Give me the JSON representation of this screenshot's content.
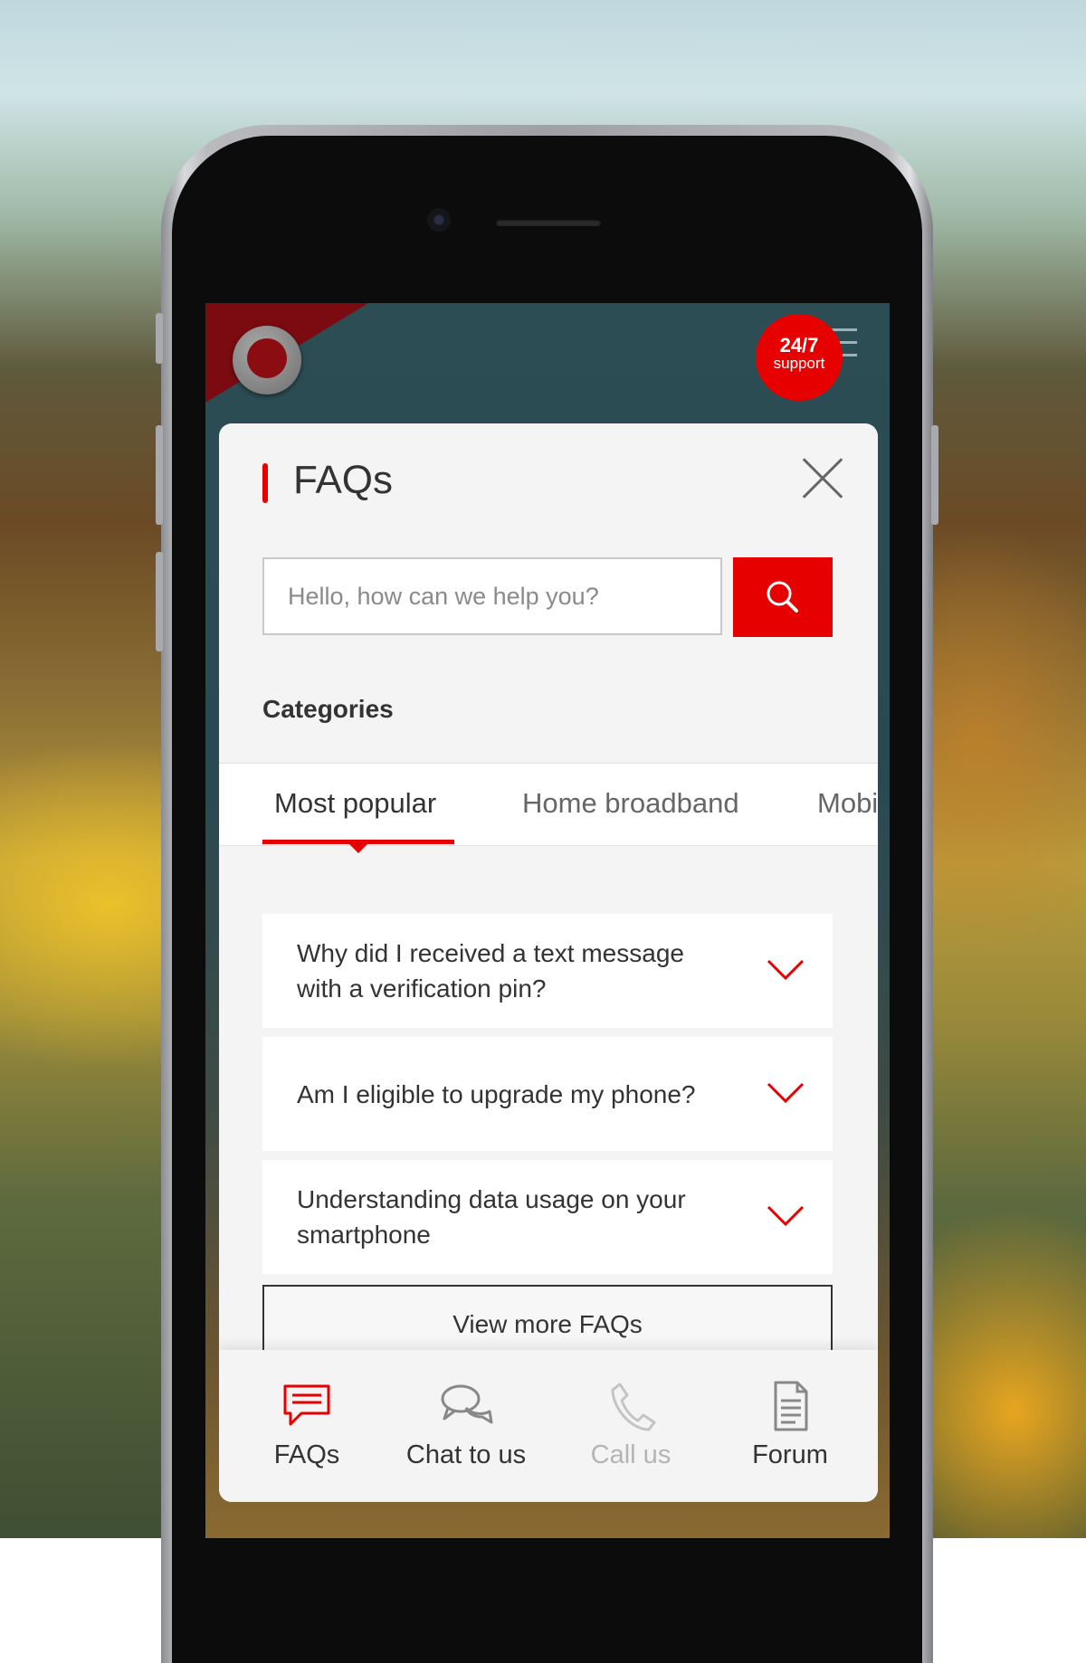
{
  "colors": {
    "accent": "#e60000",
    "text": "#333333",
    "muted": "#8a8a8a",
    "disabled": "#b4b4b4"
  },
  "header": {
    "support_badge": {
      "line1": "24/7",
      "line2": "support"
    },
    "menu_icon": "hamburger-icon",
    "logo_icon": "vodafone-logo-icon"
  },
  "panel": {
    "title": "FAQs",
    "close_icon": "close-icon",
    "search": {
      "placeholder": "Hello, how can we help you?",
      "icon": "search-icon"
    },
    "categories_heading": "Categories",
    "tabs": [
      {
        "label": "Most popular",
        "active": true
      },
      {
        "label": "Home broadband",
        "active": false
      },
      {
        "label": "Mobi",
        "active": false
      }
    ],
    "faqs": [
      {
        "question": "Why did I received a text message with a verification pin?"
      },
      {
        "question": "Am I eligible to upgrade my phone?"
      },
      {
        "question": "Understanding data usage on your smartphone"
      }
    ],
    "view_more_label": "View more FAQs"
  },
  "bottom_nav": [
    {
      "label": "FAQs",
      "icon": "faq-chat-icon",
      "state": "active"
    },
    {
      "label": "Chat to us",
      "icon": "chat-bubbles-icon",
      "state": "normal"
    },
    {
      "label": "Call us",
      "icon": "phone-icon",
      "state": "disabled"
    },
    {
      "label": "Forum",
      "icon": "document-icon",
      "state": "normal"
    }
  ]
}
